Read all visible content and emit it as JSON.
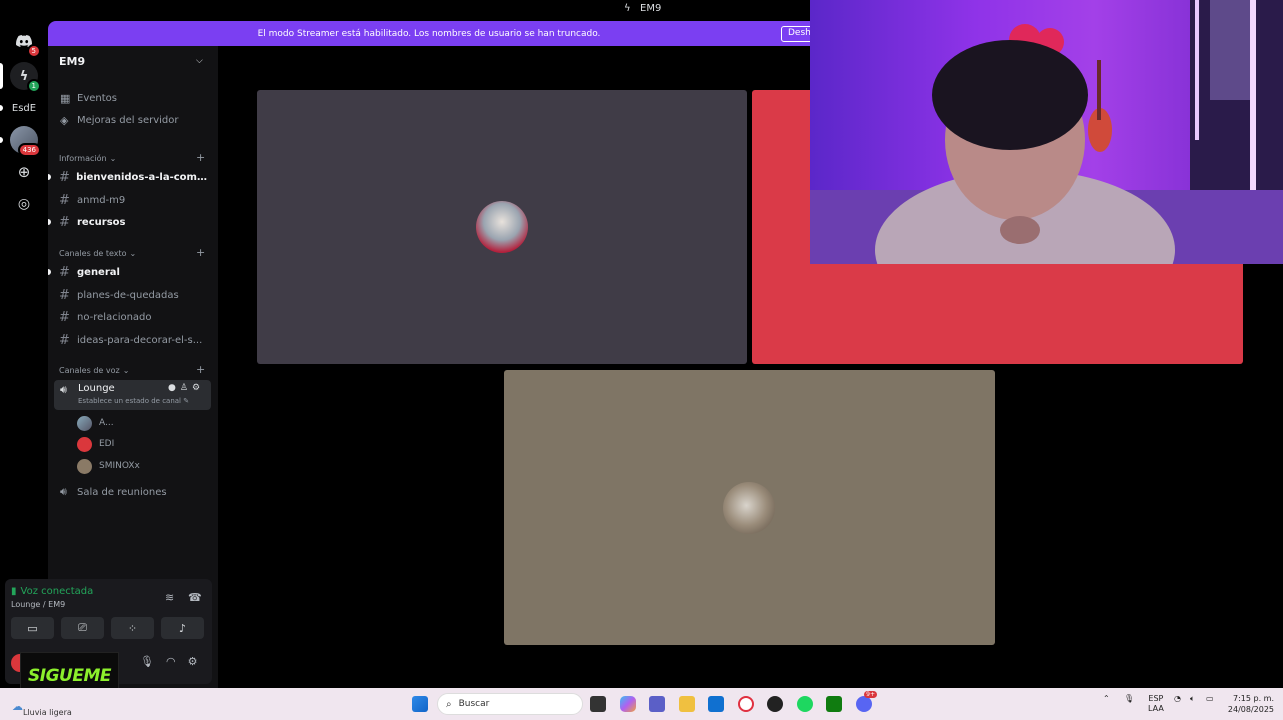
{
  "window": {
    "title": "EM9"
  },
  "banner": {
    "text": "El modo Streamer está habilitado. Los nombres de usuario se han truncado.",
    "button": "Desha"
  },
  "rail": {
    "home_badge": "5",
    "server2_badge": "1",
    "server3_label": "EsdE",
    "server4_badge": "436"
  },
  "server": {
    "name": "EM9"
  },
  "top_items": [
    {
      "label": "Eventos",
      "icon": "calendar-icon"
    },
    {
      "label": "Mejoras del servidor",
      "icon": "boost-icon"
    }
  ],
  "categories": {
    "info": "Información",
    "text": "Canales de texto",
    "voice": "Canales de voz"
  },
  "info_channels": [
    {
      "label": "bienvenidos-a-la-comun...",
      "unread": true
    },
    {
      "label": "anmd-m9",
      "unread": false
    },
    {
      "label": "recursos",
      "unread": true
    }
  ],
  "text_channels": [
    {
      "label": "general",
      "unread": true
    },
    {
      "label": "planes-de-quedadas",
      "unread": false
    },
    {
      "label": "no-relacionado",
      "unread": false
    },
    {
      "label": "ideas-para-decorar-el-s...",
      "unread": false
    }
  ],
  "voice_channel": {
    "name": "Lounge",
    "status": "Establece un estado de canal",
    "users": [
      {
        "name": "A...",
        "color": "#6c7a8c"
      },
      {
        "name": "EDI",
        "color": "#da373c"
      },
      {
        "name": "SMINOXx",
        "color": "#8a7a66"
      }
    ]
  },
  "voice_channel2": {
    "name": "Sala de reuniones"
  },
  "voice_panel": {
    "status": "Voz conectada",
    "location": "Lounge / EM9"
  },
  "overlay": {
    "sigue": "SIGUEME"
  },
  "tiles": {
    "colors": {
      "tile1": "#403c47",
      "tile2": "#da3a48",
      "tile3": "#7f7565"
    }
  },
  "taskbar": {
    "weather": "Lluvia ligera",
    "search_placeholder": "Buscar",
    "lang1": "ESP",
    "lang2": "LAA",
    "time": "7:15 p. m.",
    "date": "24/08/2025",
    "badge": "9+"
  },
  "colors": {
    "accent": "#7b3ff2",
    "green": "#23a55a",
    "red": "#da373c"
  }
}
